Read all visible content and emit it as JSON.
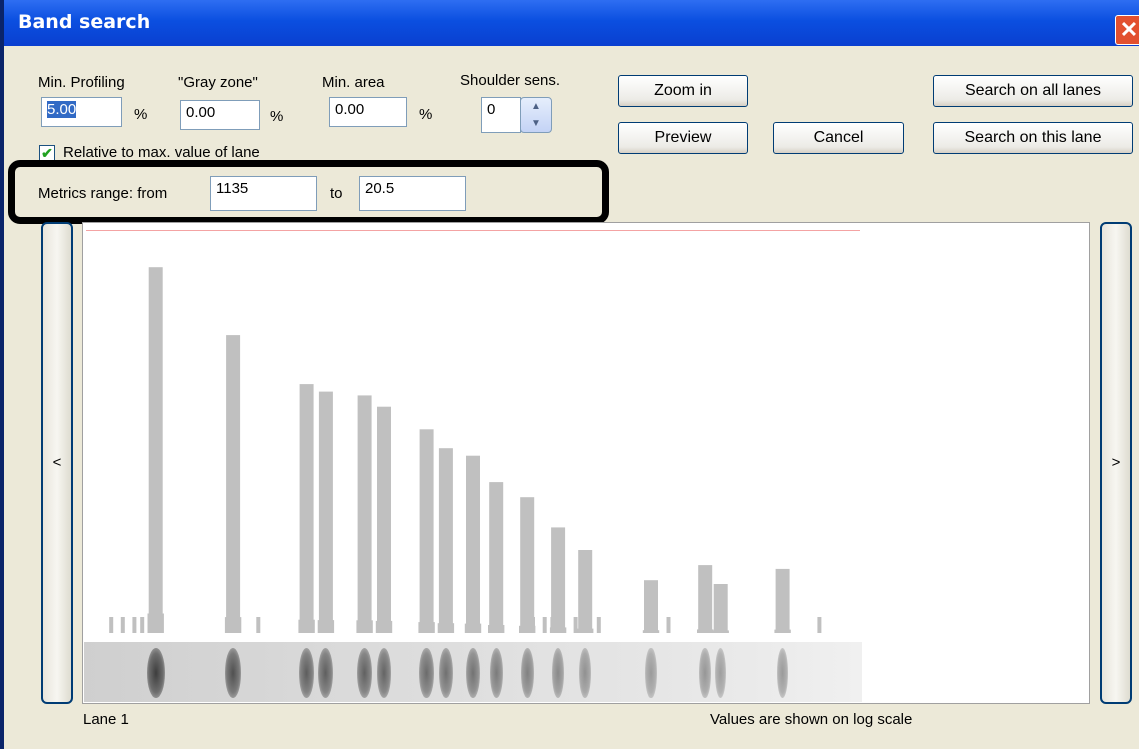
{
  "window": {
    "title": "Band search",
    "close_glyph": "✕"
  },
  "params": {
    "min_profiling": {
      "label": "Min. Profiling",
      "value": "5.00",
      "unit": "%"
    },
    "gray_zone": {
      "label": "\"Gray zone\"",
      "value": "0.00",
      "unit": "%"
    },
    "min_area": {
      "label": "Min. area",
      "value": "0.00",
      "unit": "%"
    },
    "shoulder_sens": {
      "label": "Shoulder sens.",
      "value": "0"
    },
    "relative_checkbox": {
      "label": "Relative to max. value of lane",
      "checked": true
    }
  },
  "buttons": {
    "zoom_in": "Zoom in",
    "preview": "Preview",
    "cancel": "Cancel",
    "search_all": "Search on all lanes",
    "search_this": "Search on this lane"
  },
  "metrics": {
    "label": "Metrics range: from",
    "from": "1135",
    "to_label": "to",
    "to": "20.5"
  },
  "nav": {
    "left": "<",
    "right": ">"
  },
  "footer": {
    "lane": "Lane 1",
    "note": "Values are shown on log scale"
  },
  "chart_data": {
    "type": "bar",
    "scale": "log",
    "bands": [
      {
        "x": 0.09,
        "peak": 0.97
      },
      {
        "x": 0.19,
        "peak": 0.79
      },
      {
        "x": 0.285,
        "peak": 0.66
      },
      {
        "x": 0.31,
        "peak": 0.64
      },
      {
        "x": 0.36,
        "peak": 0.63
      },
      {
        "x": 0.385,
        "peak": 0.6
      },
      {
        "x": 0.44,
        "peak": 0.54
      },
      {
        "x": 0.465,
        "peak": 0.49
      },
      {
        "x": 0.5,
        "peak": 0.47
      },
      {
        "x": 0.53,
        "peak": 0.4
      },
      {
        "x": 0.57,
        "peak": 0.36
      },
      {
        "x": 0.61,
        "peak": 0.28
      },
      {
        "x": 0.645,
        "peak": 0.22
      },
      {
        "x": 0.73,
        "peak": 0.14
      },
      {
        "x": 0.8,
        "peak": 0.18
      },
      {
        "x": 0.82,
        "peak": 0.13
      },
      {
        "x": 0.9,
        "peak": 0.17
      }
    ]
  },
  "colors": {
    "titlebar": "#0b4fe0",
    "dialog_bg": "#ece9d8",
    "bar": "#c0c0c0",
    "limit_line": "#f4a3a3"
  }
}
